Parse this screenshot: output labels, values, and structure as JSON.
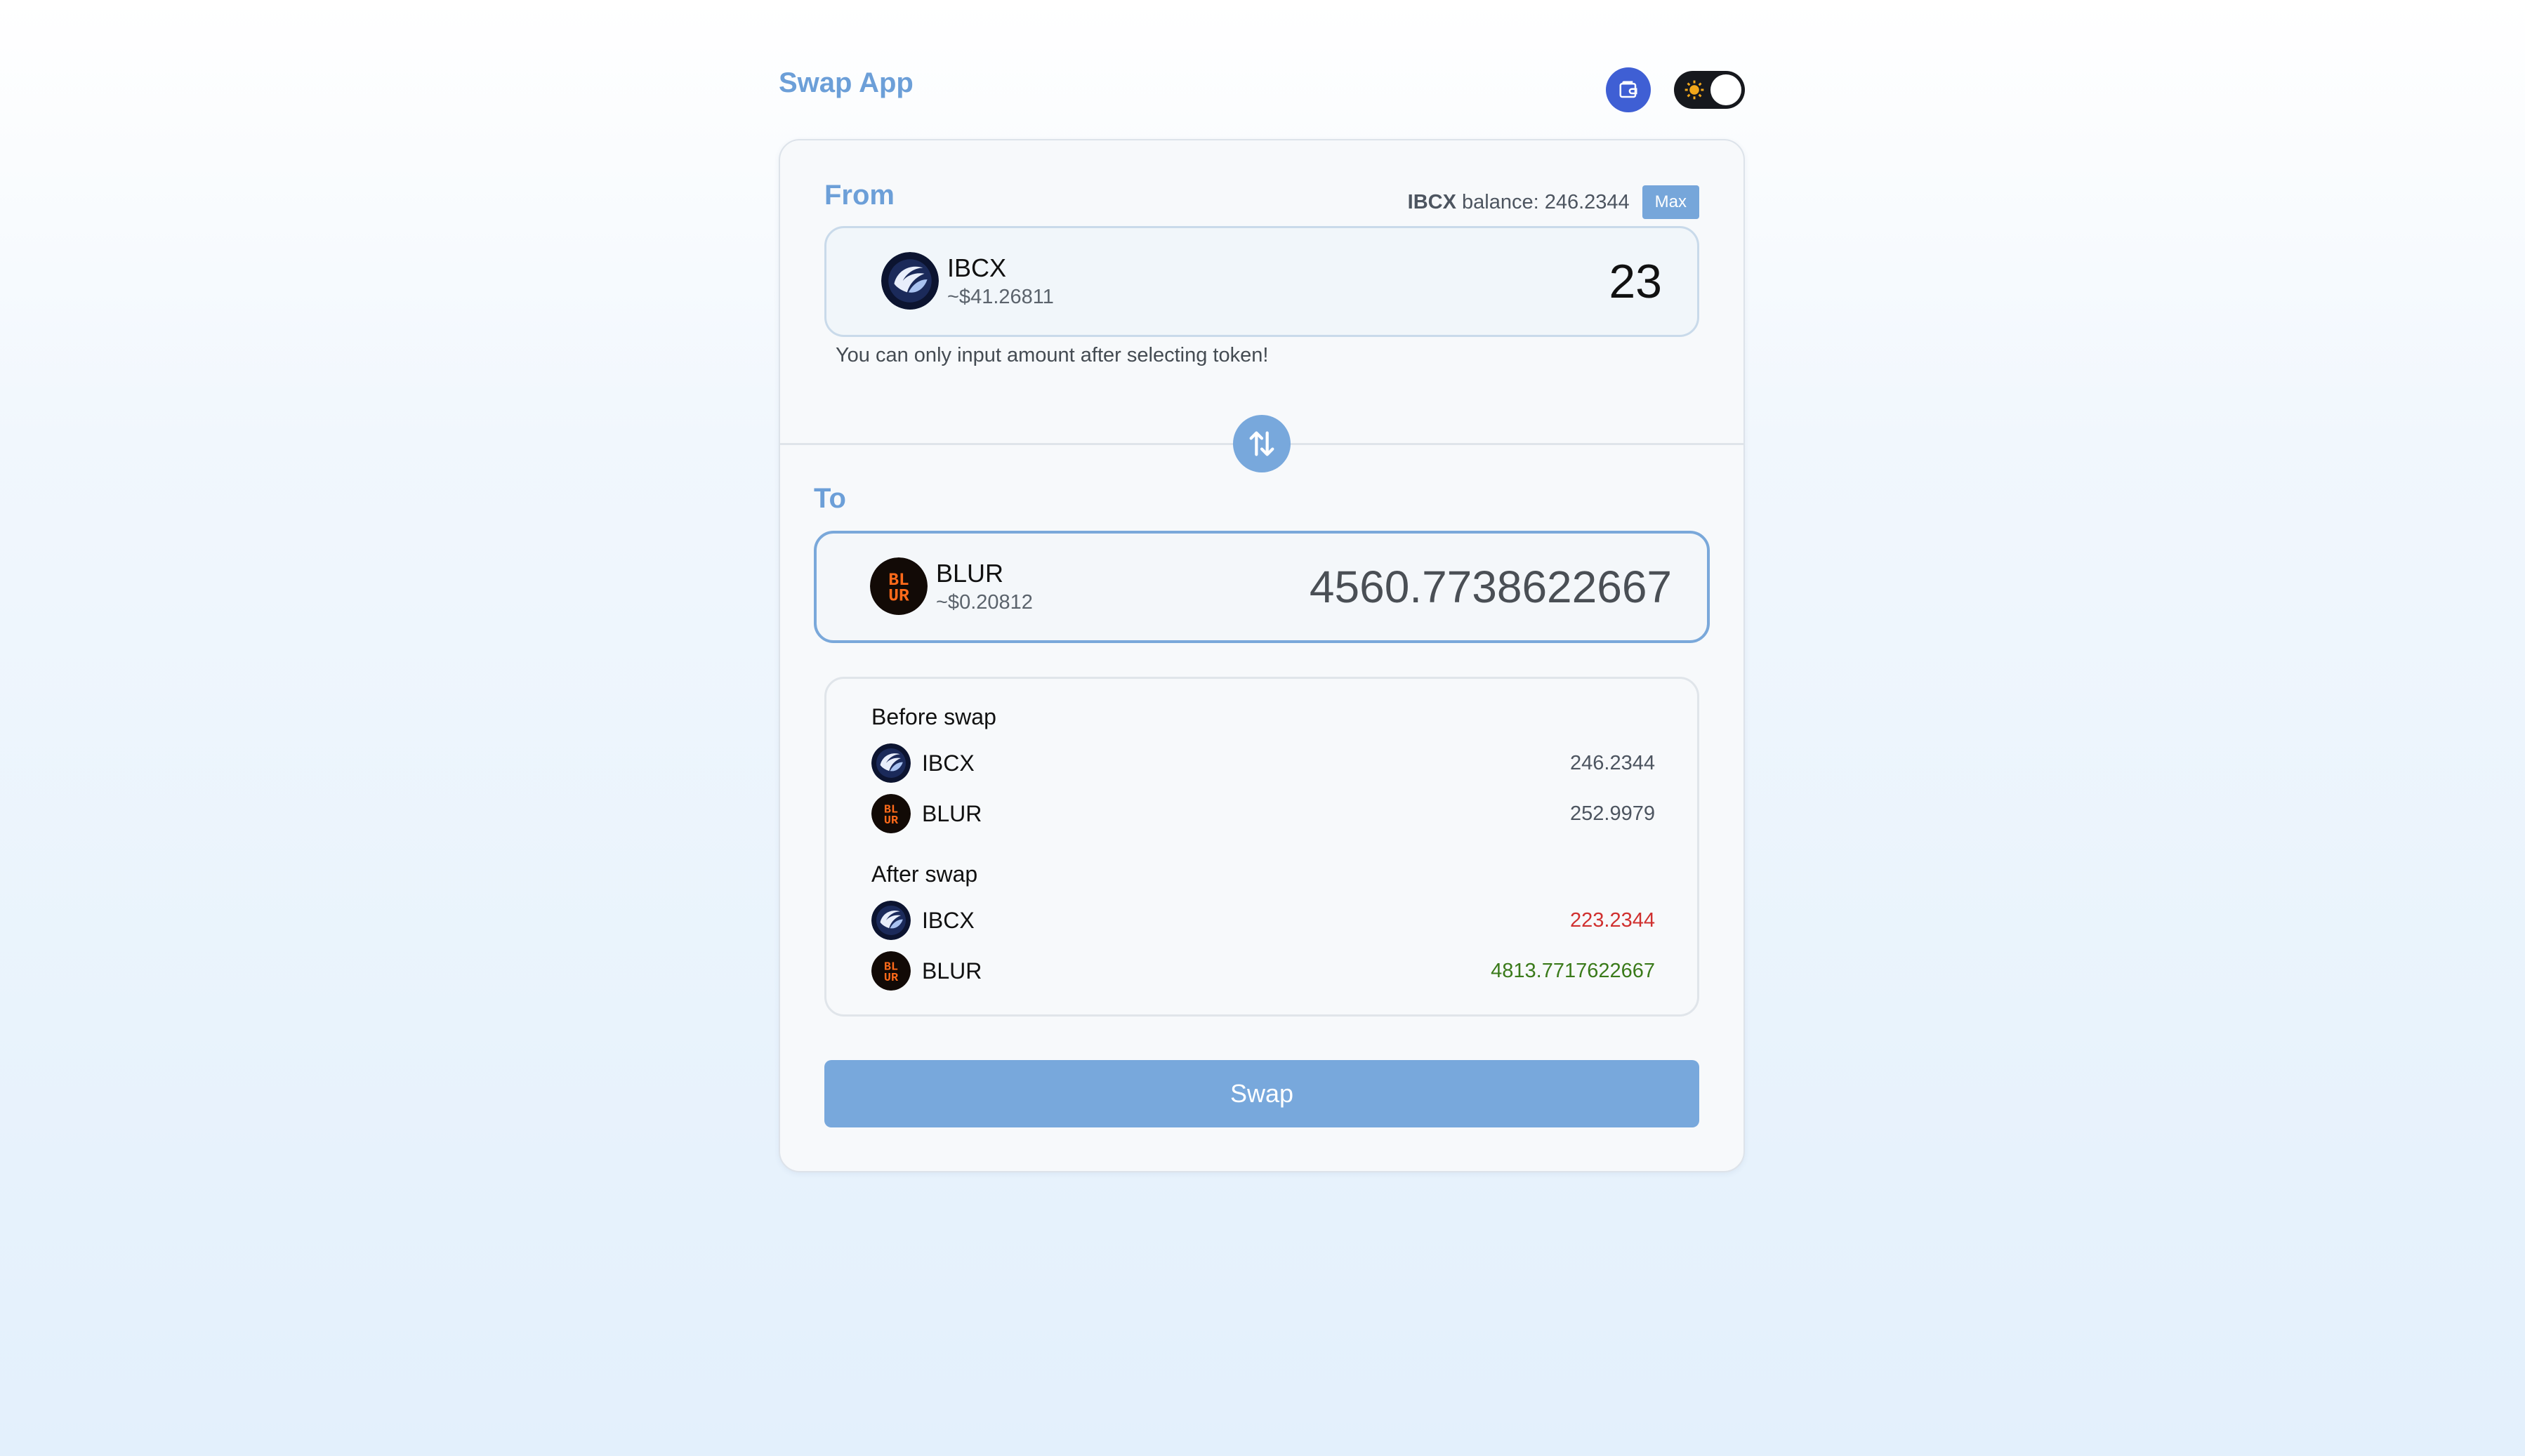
{
  "app": {
    "title": "Swap App"
  },
  "header": {
    "wallet_icon": "wallet-icon",
    "theme_icon": "sun-icon"
  },
  "from": {
    "label": "From",
    "balance_symbol": "IBCX",
    "balance_text": " balance: 246.2344",
    "max_label": "Max",
    "token": {
      "symbol": "IBCX",
      "price": "~$41.26811",
      "icon": "ibcx-token-icon"
    },
    "amount": "23",
    "hint": "You can only input amount after selecting token!"
  },
  "swap_direction_icon": "swap-arrows-icon",
  "to": {
    "label": "To",
    "token": {
      "symbol": "BLUR",
      "price": "~$0.20812",
      "icon": "blur-token-icon"
    },
    "amount": "4560.7738622667"
  },
  "summary": {
    "before": {
      "heading": "Before swap",
      "rows": [
        {
          "symbol": "IBCX",
          "value": "246.2344"
        },
        {
          "symbol": "BLUR",
          "value": "252.9979"
        }
      ]
    },
    "after": {
      "heading": "After swap",
      "rows": [
        {
          "symbol": "IBCX",
          "value": "223.2344",
          "color": "#d0302f"
        },
        {
          "symbol": "BLUR",
          "value": "4813.7717622667",
          "color": "#3a7a1a"
        }
      ]
    }
  },
  "swap_button": {
    "label": "Swap"
  },
  "colors": {
    "accent": "#6c9fd8",
    "button": "#78a8dc",
    "wallet": "#3f5fd4",
    "negative": "#d0302f",
    "positive": "#3a7a1a"
  }
}
